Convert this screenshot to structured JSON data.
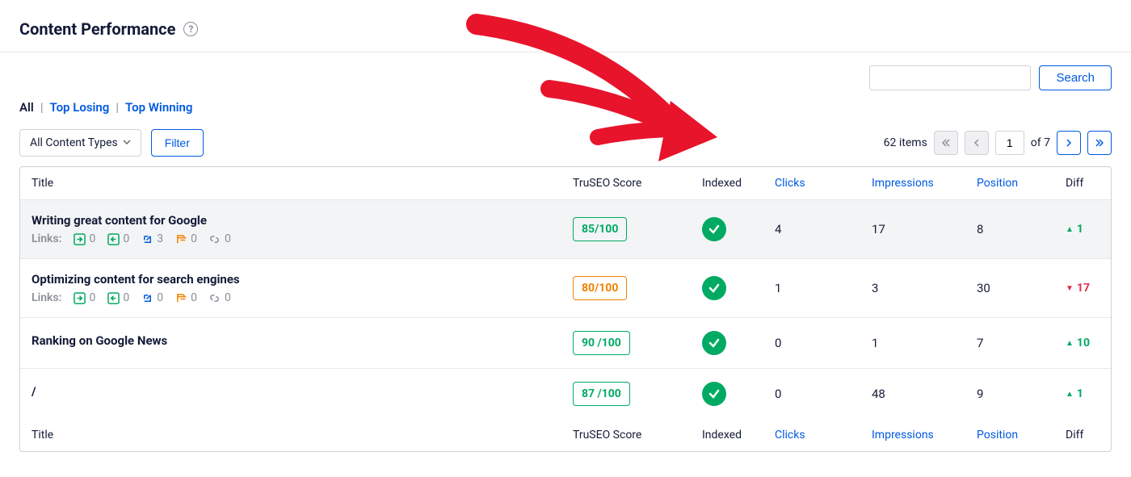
{
  "header": {
    "title": "Content Performance"
  },
  "tabs": {
    "all": "All",
    "losing": "Top Losing",
    "winning": "Top Winning"
  },
  "controls": {
    "content_types": "All Content Types",
    "filter": "Filter",
    "search": "Search",
    "items_label": "62 items",
    "page_current": "1",
    "page_of": "of 7"
  },
  "columns": {
    "title": "Title",
    "score": "TruSEO Score",
    "indexed": "Indexed",
    "clicks": "Clicks",
    "impressions": "Impressions",
    "position": "Position",
    "diff": "Diff"
  },
  "links_label": "Links:",
  "rows": [
    {
      "title": "Writing great content for Google",
      "links": {
        "inbound": "0",
        "outbound": "0",
        "external": "3",
        "affiliate": "0",
        "chain": "0"
      },
      "show_links": true,
      "score": "85/100",
      "score_color": "green",
      "clicks": "4",
      "impressions": "17",
      "position": "8",
      "diff": "1",
      "diff_dir": "up"
    },
    {
      "title": "Optimizing content for search engines",
      "links": {
        "inbound": "0",
        "outbound": "0",
        "external": "0",
        "affiliate": "0",
        "chain": "0"
      },
      "show_links": true,
      "score": "80/100",
      "score_color": "orange",
      "clicks": "1",
      "impressions": "3",
      "position": "30",
      "diff": "17",
      "diff_dir": "down"
    },
    {
      "title": "Ranking on Google News",
      "show_links": false,
      "score": "90 /100",
      "score_color": "green",
      "clicks": "0",
      "impressions": "1",
      "position": "7",
      "diff": "10",
      "diff_dir": "up"
    },
    {
      "title": "/",
      "show_links": false,
      "score": "87 /100",
      "score_color": "green",
      "clicks": "0",
      "impressions": "48",
      "position": "9",
      "diff": "1",
      "diff_dir": "up"
    }
  ]
}
